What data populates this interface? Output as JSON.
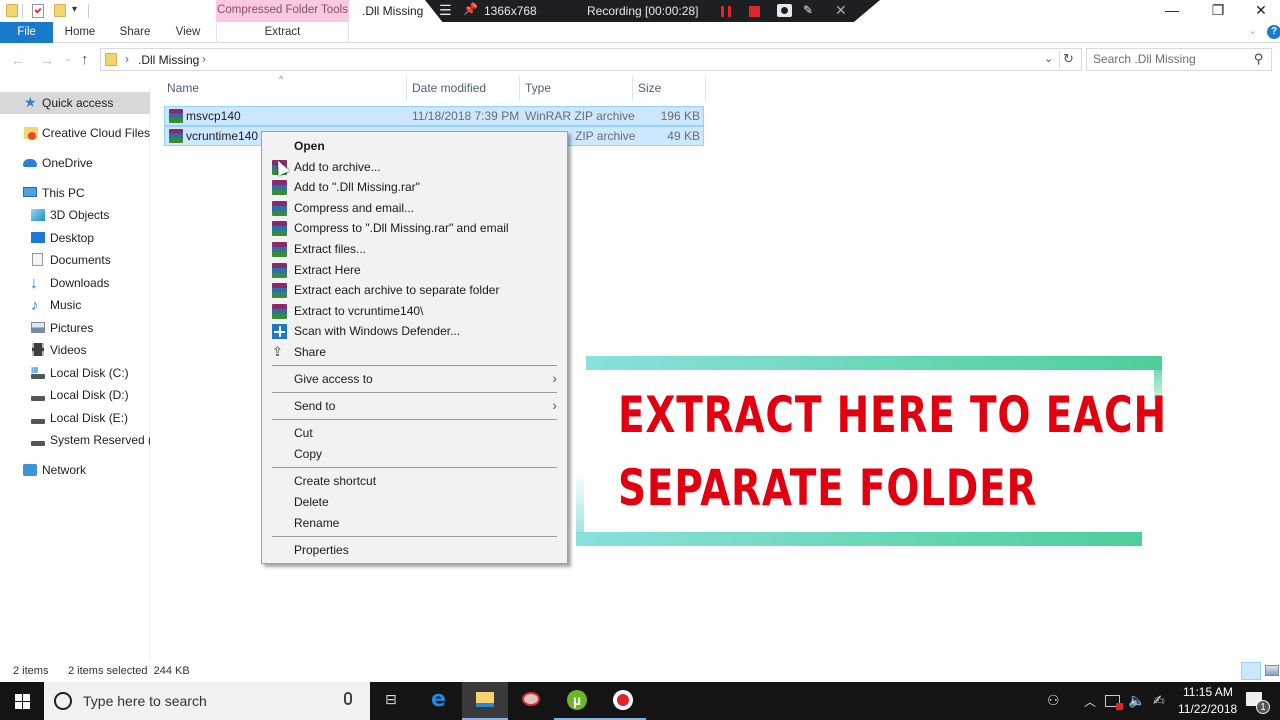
{
  "window": {
    "title": ".Dll Missing",
    "context_tab": "Compressed Folder Tools",
    "controls": {
      "minimize": "—",
      "restore": "❐",
      "close": "✕"
    }
  },
  "recorder": {
    "resolution": "1366x768",
    "status": "Recording [00:00:28]",
    "colors": {
      "pause": "#e0262b",
      "stop": "#e0262b"
    }
  },
  "ribbon": {
    "tabs": [
      {
        "label": "File",
        "active": true
      },
      {
        "label": "Home"
      },
      {
        "label": "Share"
      },
      {
        "label": "View"
      },
      {
        "label": "Extract"
      }
    ]
  },
  "address": {
    "path": [
      ".Dll Missing"
    ],
    "search_placeholder": "Search .Dll Missing"
  },
  "sidebar": {
    "items": [
      {
        "label": "Quick access",
        "icon": "star-icon",
        "active": true
      },
      {
        "label": "Creative Cloud Files",
        "icon": "creative-cloud-icon"
      },
      {
        "label": "OneDrive",
        "icon": "onedrive-icon"
      },
      {
        "label": "This PC",
        "icon": "computer-icon"
      },
      {
        "label": "3D Objects",
        "icon": "cube-icon"
      },
      {
        "label": "Desktop",
        "icon": "desktop-icon"
      },
      {
        "label": "Documents",
        "icon": "document-icon"
      },
      {
        "label": "Downloads",
        "icon": "download-icon"
      },
      {
        "label": "Music",
        "icon": "music-icon"
      },
      {
        "label": "Pictures",
        "icon": "pictures-icon"
      },
      {
        "label": "Videos",
        "icon": "videos-icon"
      },
      {
        "label": "Local Disk (C:)",
        "icon": "drive-icon"
      },
      {
        "label": "Local Disk (D:)",
        "icon": "drive-icon"
      },
      {
        "label": "Local Disk (E:)",
        "icon": "drive-icon"
      },
      {
        "label": "System Reserved (F:",
        "icon": "drive-icon"
      },
      {
        "label": "Network",
        "icon": "network-icon"
      }
    ]
  },
  "file_list": {
    "columns": [
      "Name",
      "Date modified",
      "Type",
      "Size"
    ],
    "rows": [
      {
        "name": "msvcp140",
        "date": "11/18/2018 7:39 PM",
        "type": "WinRAR ZIP archive",
        "size": "196 KB",
        "selected": true
      },
      {
        "name": "vcruntime140",
        "date": "",
        "type": "ZIP archive",
        "size": "49 KB",
        "selected": true
      }
    ]
  },
  "context_menu": {
    "items": [
      {
        "label": "Open",
        "bold": true
      },
      {
        "label": "Add to archive...",
        "icon": "winrar-icon"
      },
      {
        "label": "Add to \".Dll Missing.rar\"",
        "icon": "winrar-icon"
      },
      {
        "label": "Compress and email...",
        "icon": "winrar-icon"
      },
      {
        "label": "Compress to \".Dll Missing.rar\" and email",
        "icon": "winrar-icon"
      },
      {
        "label": "Extract files...",
        "icon": "winrar-icon"
      },
      {
        "label": "Extract Here",
        "icon": "winrar-icon"
      },
      {
        "label": "Extract each archive to separate folder",
        "icon": "winrar-icon"
      },
      {
        "label": "Extract to vcruntime140\\",
        "icon": "winrar-icon"
      },
      {
        "label": "Scan with Windows Defender...",
        "icon": "defender-icon"
      },
      {
        "label": "Share",
        "icon": "share-icon"
      },
      {
        "label": "Give access to",
        "submenu": true
      },
      {
        "label": "Send to",
        "submenu": true
      },
      {
        "label": "Cut"
      },
      {
        "label": "Copy"
      },
      {
        "label": "Create shortcut"
      },
      {
        "label": "Delete"
      },
      {
        "label": "Rename"
      },
      {
        "label": "Properties"
      }
    ]
  },
  "banner": {
    "line1": "EXTRACT HERE TO EACH",
    "line2": "SEPARATE FOLDER",
    "text_color": "#e1000f",
    "frame_colors": [
      "#8be0dc",
      "#4ccf98"
    ]
  },
  "status_bar": {
    "item_count": "2 items",
    "selection": "2 items selected  244 KB"
  },
  "taskbar": {
    "search_placeholder": "Type here to search",
    "time": "11:15 AM",
    "date": "11/22/2018",
    "notification_count": "1"
  }
}
